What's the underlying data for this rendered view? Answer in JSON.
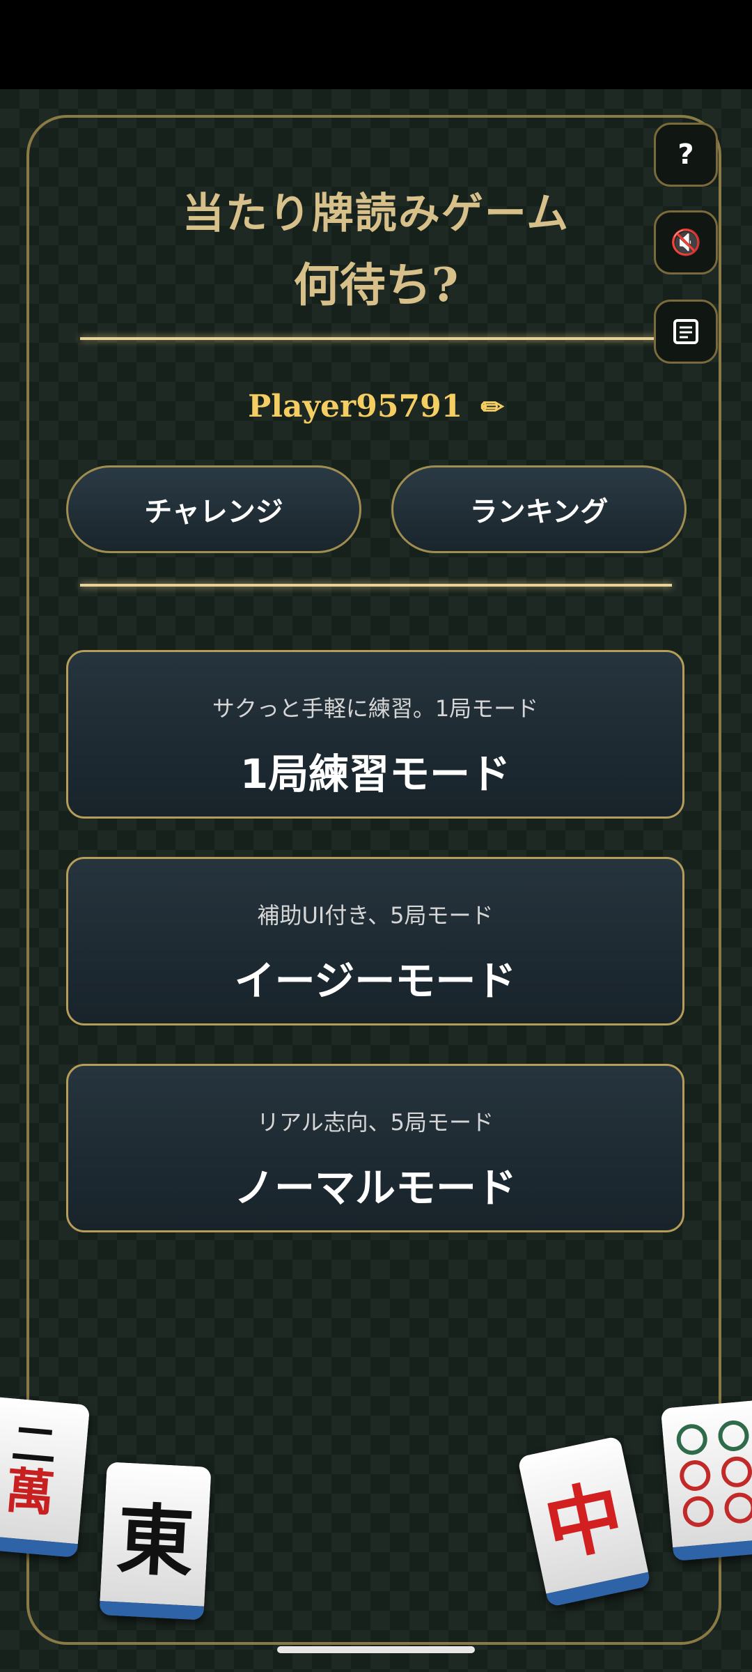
{
  "title": {
    "line1": "当たり牌読みゲーム",
    "line2": "何待ち?"
  },
  "side_buttons": {
    "help": "?",
    "sound": "🔇",
    "log": "▤"
  },
  "player": {
    "name": "Player95791",
    "edit_icon": "✏"
  },
  "nav": {
    "challenge": "チャレンジ",
    "ranking": "ランキング"
  },
  "modes": [
    {
      "subtitle": "サクっと手軽に練習。1局モード",
      "title": "1局練習モード"
    },
    {
      "subtitle": "補助UI付き、5局モード",
      "title": "イージーモード"
    },
    {
      "subtitle": "リアル志向、5局モード",
      "title": "ノーマルモード"
    }
  ],
  "tiles": {
    "left": "二",
    "left_sub": "萬",
    "east": "東",
    "center": "中"
  },
  "colors": {
    "gold": "#d8c08a",
    "player": "#f4cd63",
    "tile_back": "#2f63a8"
  }
}
